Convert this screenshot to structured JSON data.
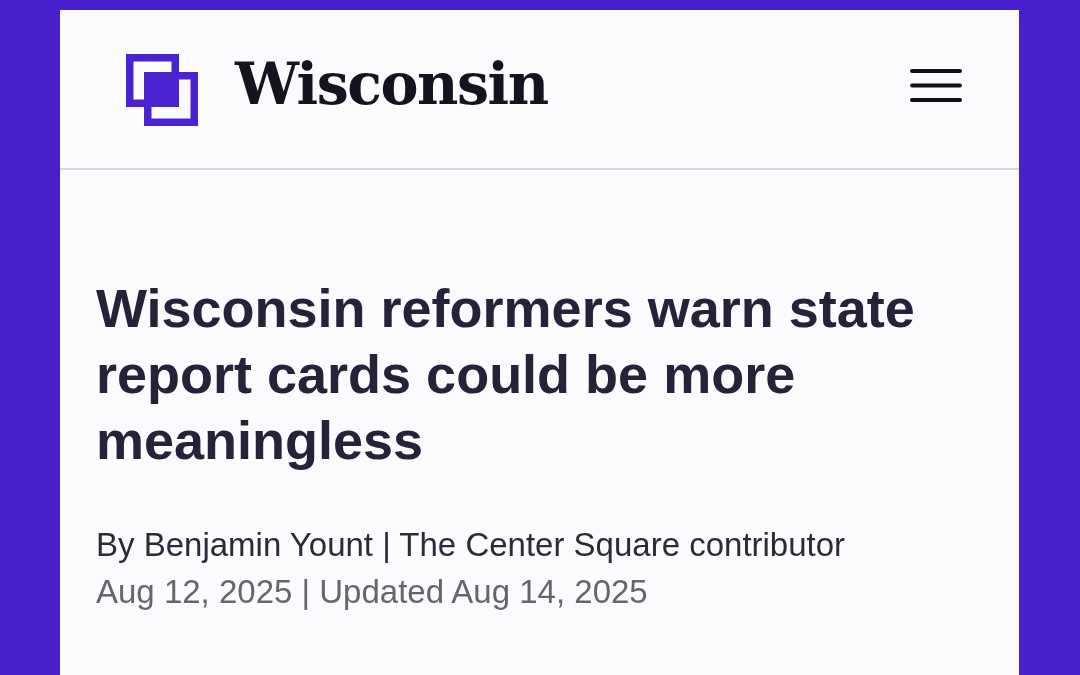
{
  "header": {
    "site_name": "Wisconsin"
  },
  "article": {
    "headline": "Wisconsin reformers warn state report cards could be more meaningless",
    "byline": "By Benjamin Yount | The Center Square contributor",
    "dateline": "Aug 12, 2025 | Updated Aug 14, 2025"
  }
}
